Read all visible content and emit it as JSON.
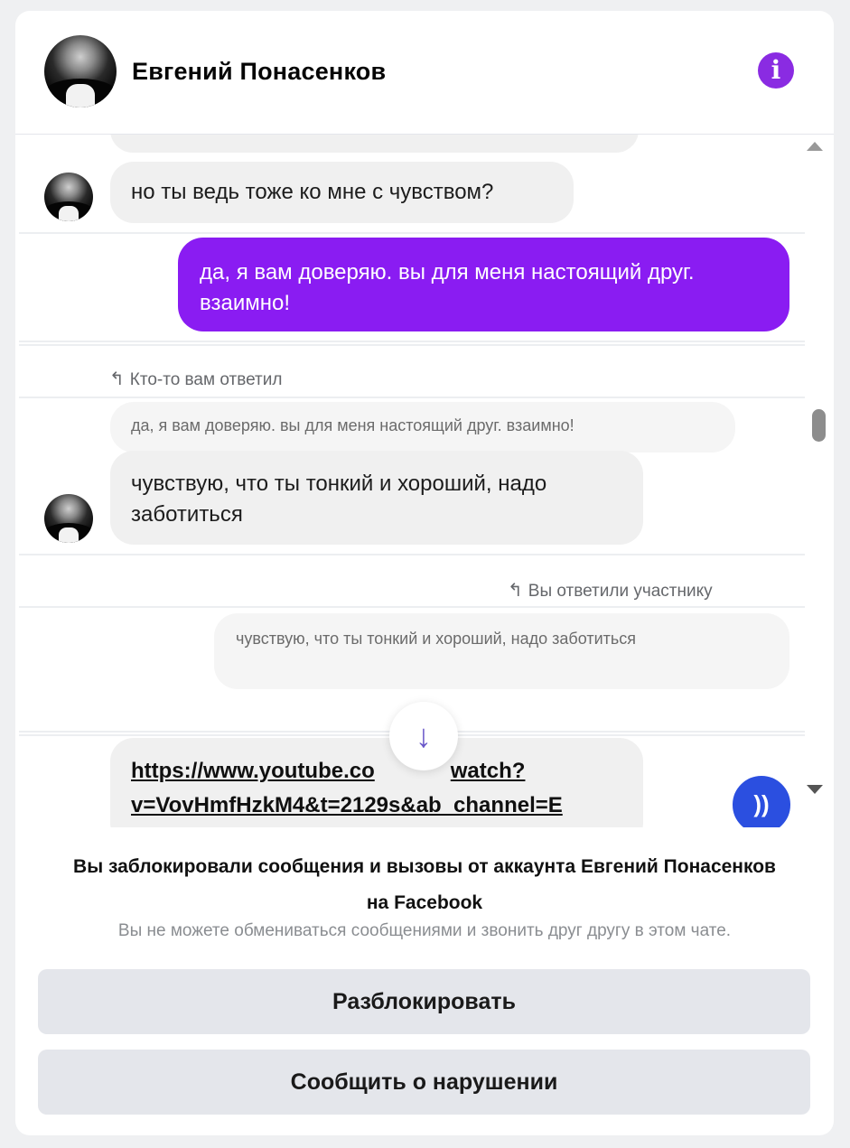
{
  "header": {
    "contact_name": "Евгений Понасенков",
    "info_icon": "info-icon",
    "accent_color": "#8a2be2"
  },
  "messages": [
    {
      "direction": "incoming",
      "text": "но ты ведь тоже ко мне с чувством?"
    },
    {
      "direction": "outgoing",
      "text": "да, я вам доверяю. вы для меня настоящий друг. взаимно!"
    },
    {
      "direction": "incoming",
      "reply_label": "Кто-то вам ответил",
      "quoted": "да, я вам доверяю. вы для меня настоящий друг. взаимно!",
      "text": "чувствую, что ты тонкий и хороший, надо заботиться"
    },
    {
      "direction": "outgoing",
      "reply_label": "Вы ответили участнику",
      "quoted": "чувствую, что ты тонкий и хороший, надо заботиться",
      "reaction": "))"
    },
    {
      "direction": "incoming",
      "link": "https://www.youtube.com/watch?v=VovHmfHzkM4&t=2129s&ab_channel=E"
    }
  ],
  "link_line1": "https://www.youtube.co",
  "link_line1b": "watch?",
  "link_line2": "v=VovHmfHzkM4&t=2129s&ab_channel=E",
  "footer": {
    "title_line1": "Вы заблокировали сообщения и вызовы от аккаунта Евгений Понасенков",
    "title_line2": "на Facebook",
    "subtitle": "Вы не можете обмениваться сообщениями и звонить друг другу в этом чате.",
    "unblock_label": "Разблокировать",
    "report_label": "Сообщить о нарушении"
  },
  "colors": {
    "outgoing_bubble": "#8a1cf2",
    "reaction_badge": "#2b4fe0"
  }
}
